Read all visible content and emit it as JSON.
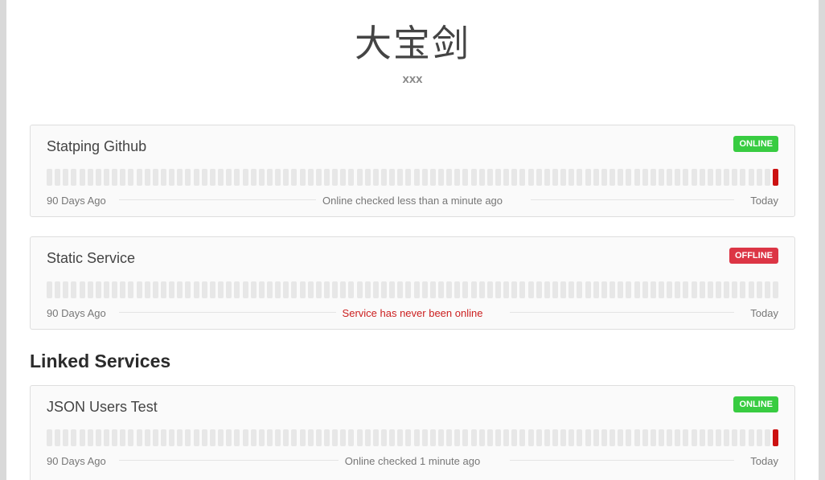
{
  "header": {
    "title": "大宝剑",
    "subtitle": "xxx"
  },
  "services": [
    {
      "name": "Statping Github",
      "status": "ONLINE",
      "status_kind": "online",
      "range_start": "90 Days Ago",
      "range_end": "Today",
      "message": "Online checked less than a minute ago",
      "message_kind": "normal",
      "bar_count": 90,
      "failed_bars": [
        89
      ]
    },
    {
      "name": "Static Service",
      "status": "OFFLINE",
      "status_kind": "offline",
      "range_start": "90 Days Ago",
      "range_end": "Today",
      "message": "Service has never been online",
      "message_kind": "error",
      "bar_count": 90,
      "failed_bars": []
    }
  ],
  "linked": {
    "title": "Linked Services",
    "services": [
      {
        "name": "JSON Users Test",
        "status": "ONLINE",
        "status_kind": "online",
        "range_start": "90 Days Ago",
        "range_end": "Today",
        "message": "Online checked 1 minute ago",
        "message_kind": "normal",
        "bar_count": 90,
        "failed_bars": [
          89
        ]
      }
    ]
  },
  "colors": {
    "online": "#38cc41",
    "offline": "#dc3545",
    "bar_ok": "#e7e7e7",
    "bar_fail": "#cc1111"
  }
}
